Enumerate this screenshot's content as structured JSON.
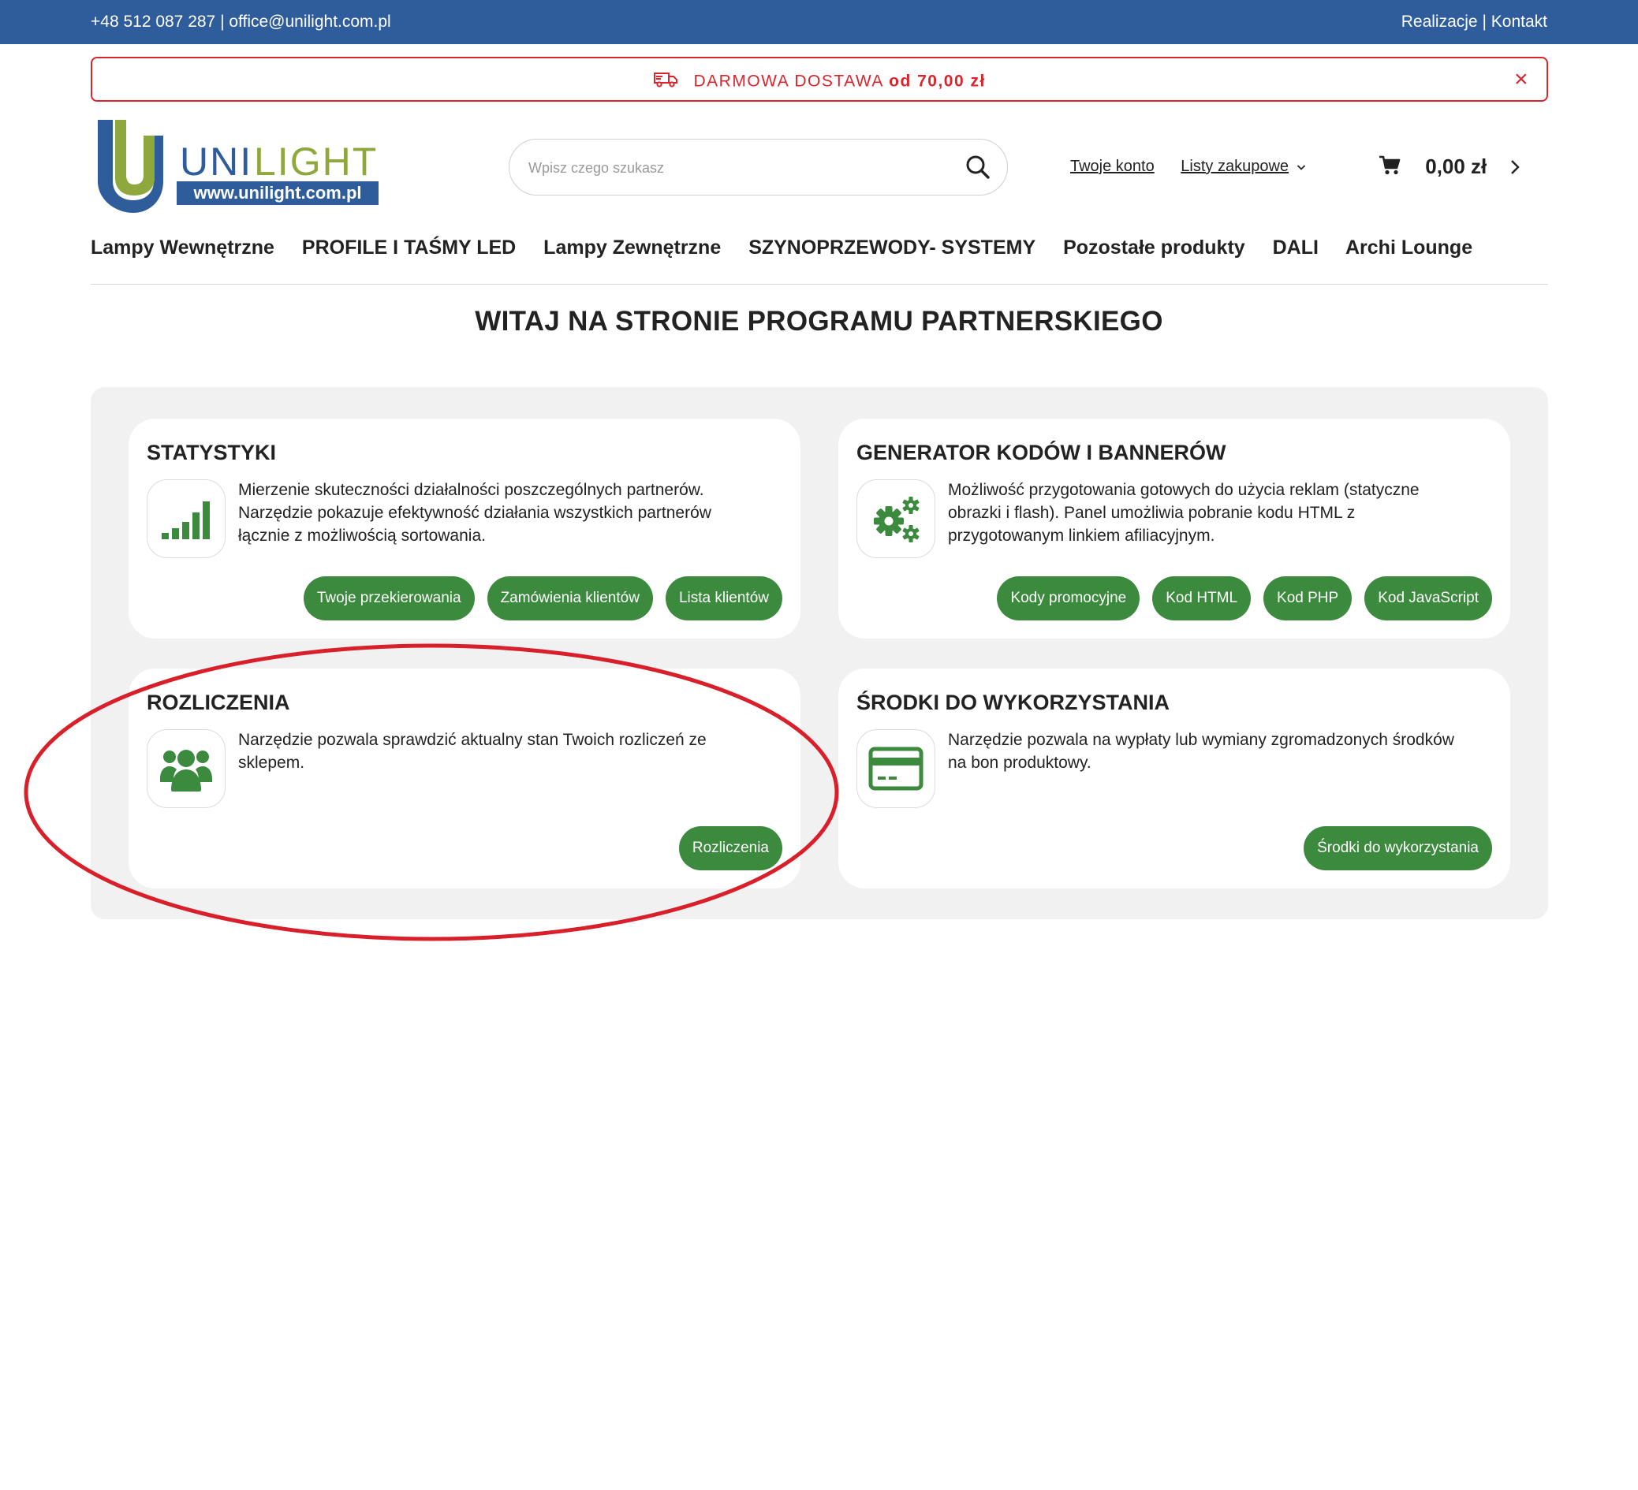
{
  "topbar": {
    "contact": "+48 512 087 287 | office@unilight.com.pl",
    "realizacje": "Realizacje",
    "separator": "|",
    "kontakt": "Kontakt"
  },
  "promo": {
    "text": "DARMOWA DOSTAWA",
    "amount": "od 70,00 zł",
    "close": "×"
  },
  "logo": {
    "name_part1": "UNI",
    "name_part2": "LIGHT",
    "url": "www.unilight.com.pl"
  },
  "search": {
    "placeholder": "Wpisz czego szukasz"
  },
  "header": {
    "account": "Twoje konto",
    "shopping_lists": "Listy zakupowe",
    "cart_total": "0,00 zł"
  },
  "nav": [
    "Lampy Wewnętrzne",
    "PROFILE I TAŚMY LED",
    "Lampy Zewnętrzne",
    "SZYNOPRZEWODY- SYSTEMY",
    "Pozostałe produkty",
    "DALI",
    "Archi Lounge"
  ],
  "page_title": "WITAJ NA STRONIE PROGRAMU PARTNERSKIEGO",
  "cards": [
    {
      "title": "STATYSTYKI",
      "icon": "signal-bars-icon",
      "lines": [
        "Mierzenie skuteczności działalności poszczególnych partnerów.",
        "Narzędzie pokazuje efektywność działania wszystkich partnerów",
        "łącznie z możliwością sortowania."
      ],
      "buttons": [
        "Twoje przekierowania",
        "Zamówienia klientów",
        "Lista klientów"
      ]
    },
    {
      "title": "GENERATOR KODÓW I BANNERÓW",
      "icon": "gears-icon",
      "lines": [
        "Możliwość przygotowania gotowych do użycia reklam (statyczne",
        "obrazki i flash). Panel umożliwia pobranie kodu HTML z",
        "przygotowanym linkiem afiliacyjnym."
      ],
      "buttons": [
        "Kody promocyjne",
        "Kod HTML",
        "Kod PHP",
        "Kod JavaScript"
      ]
    },
    {
      "title": "ROZLICZENIA",
      "icon": "users-icon",
      "lines": [
        "Narzędzie pozwala sprawdzić aktualny stan Twoich rozliczeń ze",
        "sklepem."
      ],
      "buttons": [
        "Rozliczenia"
      ]
    },
    {
      "title": "ŚRODKI DO WYKORZYSTANIA",
      "icon": "credit-card-icon",
      "lines": [
        "Narzędzie pozwala na wypłaty lub wymiany zgromadzonych środków",
        "na bon produktowy."
      ],
      "buttons": [
        "Środki do wykorzystania"
      ]
    }
  ],
  "colors": {
    "topbar": "#2f5c9a",
    "accent_green": "#3b8a3d",
    "promo_red": "#d9252c",
    "annotation_red": "#d9202a",
    "panel_bg": "#f1f1f1"
  }
}
